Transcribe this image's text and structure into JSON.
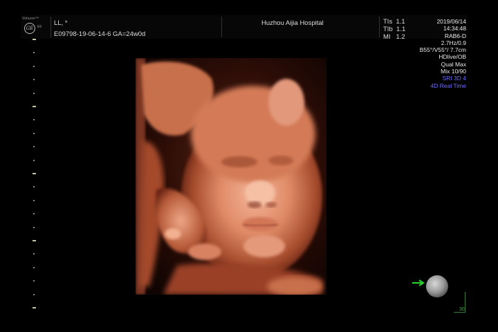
{
  "logo": {
    "brand": "Voluson™",
    "model": "E6"
  },
  "patient": {
    "name": "LL,  *",
    "id_line": "E09798-19-06-14-6   GA=24w0d"
  },
  "hospital": "Huzhou Aijia Hospital",
  "thermal": [
    {
      "label": "TIs",
      "value": "1.1"
    },
    {
      "label": "TIb",
      "value": "1.1"
    },
    {
      "label": "MI",
      "value": "1.2"
    }
  ],
  "right_info": {
    "date": "2019/06/14",
    "time": "14:34:48",
    "probe": "RAB6-D",
    "freq": "2.7Hz/0.9",
    "angle": "B55°/V55°/ 7.7cm",
    "mode": "HDlive/OB",
    "quality": "Qual Max",
    "mix": "Mix 10/90",
    "sri": "SRI 3D 4",
    "realtime": "4D Real Time"
  },
  "orientation": {
    "label": "30"
  },
  "colors": {
    "accent_blue": "#6d6dff",
    "orientation_green": "#2ecc2e",
    "skin_tone": "#e08a66"
  }
}
